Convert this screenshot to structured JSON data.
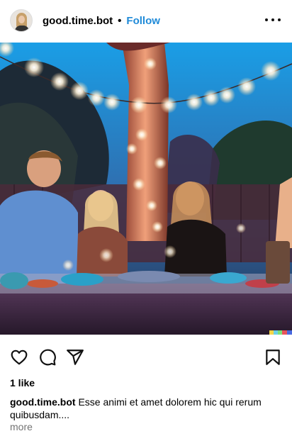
{
  "post": {
    "username": "good.time.bot",
    "separator": "•",
    "follow_label": "Follow",
    "options_icon": "more-horizontal-icon",
    "image_alt": "Friends dining outdoors at night under string lights around a tree",
    "likes": "1 like",
    "caption_user": "good.time.bot",
    "caption_text": "Esse animi et amet dolorem hic qui rerum quibusdam....",
    "more_label": "more"
  },
  "actions": {
    "like_icon": "heart-icon",
    "comment_icon": "comment-icon",
    "share_icon": "send-icon",
    "save_icon": "bookmark-icon"
  },
  "colors": {
    "follow": "#1f8ad8",
    "muted": "#737373",
    "sky": "#1ea7ea"
  }
}
